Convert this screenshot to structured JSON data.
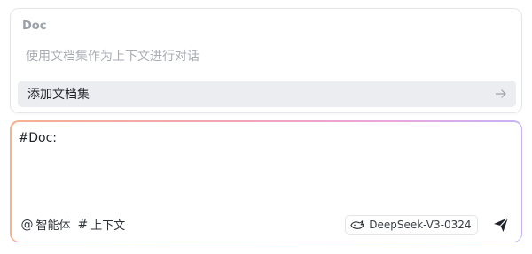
{
  "popup": {
    "section_title": "Doc",
    "hint": "使用文档集作为上下文进行对话",
    "item_label": "添加文档集",
    "item_icon": "arrow-right-icon"
  },
  "composer": {
    "text": "#Doc:",
    "agent_chip": {
      "glyph": "@",
      "label": "智能体",
      "icon": "at-icon"
    },
    "context_chip": {
      "glyph": "#",
      "label": "上下文",
      "icon": "hash-icon"
    },
    "model": {
      "label": "DeepSeek-V3-0324",
      "icon": "deepseek-whale-icon"
    },
    "send_icon": "send-icon"
  },
  "colors": {
    "gradient_start": "#f6b191",
    "gradient_mid": "#f2a3b7",
    "gradient_end": "#c3b3f6",
    "item_highlight": "#ebedf0",
    "muted_text": "#a8adb5"
  }
}
